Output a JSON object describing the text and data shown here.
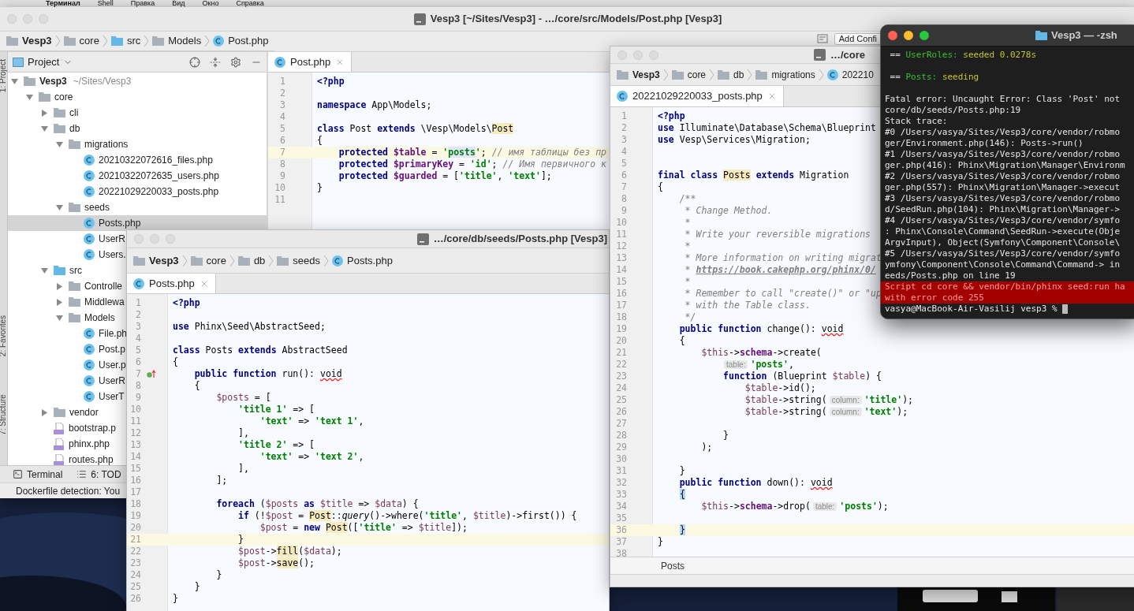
{
  "menu_bar": {
    "items": [
      "Терминал",
      "Shell",
      "Правка",
      "Вид",
      "Окно",
      "Справка"
    ]
  },
  "main_window": {
    "focused": false,
    "title": "Vesp3 [~/Sites/Vesp3] - …/core/src/Models/Post.php [Vesp3]",
    "breadcrumb": [
      {
        "kind": "folder",
        "text": "Vesp3"
      },
      {
        "kind": "folder",
        "text": "core"
      },
      {
        "kind": "source",
        "text": "src"
      },
      {
        "kind": "folder",
        "text": "Models"
      },
      {
        "kind": "class",
        "text": "Post.php"
      }
    ],
    "run_config": "Add Confi",
    "side_tabs": [
      "1: Project",
      "2: Favorites",
      "7: Structure"
    ],
    "project_panel": {
      "header": "Project",
      "tree": [
        {
          "label": "Vesp3",
          "path": "~/Sites/Vesp3",
          "kind": "folder",
          "expanded": true,
          "selected": false,
          "children": [
            {
              "label": "core",
              "kind": "folder",
              "expanded": true,
              "selected": false,
              "children": [
                {
                  "label": "cli",
                  "kind": "folder",
                  "expanded": false,
                  "selected": false
                },
                {
                  "label": "db",
                  "kind": "folder",
                  "expanded": true,
                  "selected": false,
                  "children": [
                    {
                      "label": "migrations",
                      "kind": "folder",
                      "expanded": true,
                      "selected": false,
                      "children": [
                        {
                          "label": "20210322072616_files.php",
                          "kind": "class",
                          "selected": false
                        },
                        {
                          "label": "20210322072635_users.php",
                          "kind": "class",
                          "selected": false
                        },
                        {
                          "label": "20221029220033_posts.php",
                          "kind": "class",
                          "selected": false
                        }
                      ]
                    },
                    {
                      "label": "seeds",
                      "kind": "folder",
                      "expanded": true,
                      "selected": false,
                      "children": [
                        {
                          "label": "Posts.php",
                          "kind": "class",
                          "selected": true
                        },
                        {
                          "label": "UserR",
                          "kind": "class",
                          "selected": false
                        },
                        {
                          "label": "Users.",
                          "kind": "class",
                          "selected": false
                        }
                      ]
                    }
                  ]
                },
                {
                  "label": "src",
                  "kind": "source",
                  "expanded": true,
                  "selected": false,
                  "children": [
                    {
                      "label": "Controlle",
                      "kind": "folder",
                      "expanded": false,
                      "selected": false
                    },
                    {
                      "label": "Middlewa",
                      "kind": "folder",
                      "expanded": false,
                      "selected": false
                    },
                    {
                      "label": "Models",
                      "kind": "folder",
                      "expanded": true,
                      "selected": false,
                      "children": [
                        {
                          "label": "File.ph",
                          "kind": "class",
                          "selected": false
                        },
                        {
                          "label": "Post.p",
                          "kind": "class",
                          "selected": false
                        },
                        {
                          "label": "User.p",
                          "kind": "class",
                          "selected": false
                        },
                        {
                          "label": "UserR",
                          "kind": "class",
                          "selected": false
                        },
                        {
                          "label": "UserT",
                          "kind": "class",
                          "selected": false
                        }
                      ]
                    }
                  ]
                },
                {
                  "label": "vendor",
                  "kind": "folder",
                  "expanded": false,
                  "selected": false
                },
                {
                  "label": "bootstrap.p",
                  "kind": "php",
                  "selected": false
                },
                {
                  "label": "phinx.php",
                  "kind": "php",
                  "selected": false
                },
                {
                  "label": "routes.php",
                  "kind": "php",
                  "selected": false
                }
              ]
            }
          ]
        }
      ]
    },
    "tabs": [
      {
        "label": "Post.php",
        "selected": true
      }
    ],
    "lines": [
      {
        "n": "1",
        "current": false,
        "tokens": [
          {
            "kind": "kw",
            "text": "<?php"
          }
        ]
      },
      {
        "n": "2",
        "current": false
      },
      {
        "n": "3",
        "current": false,
        "tokens": [
          {
            "kind": "kw",
            "text": "namespace"
          },
          {
            "kind": "plain",
            "text": " App\\Models;"
          }
        ]
      },
      {
        "n": "4",
        "current": false
      },
      {
        "n": "5",
        "current": false,
        "tokens": [
          {
            "kind": "kw",
            "text": "class"
          },
          {
            "kind": "plain",
            "text": " Post "
          },
          {
            "kind": "kw",
            "text": "extends"
          },
          {
            "kind": "plain",
            "text": " \\Vesp\\Models\\"
          },
          {
            "kind": "mark",
            "text": "Post"
          }
        ]
      },
      {
        "n": "6",
        "current": false,
        "tokens": [
          {
            "kind": "plain",
            "text": "{"
          }
        ]
      },
      {
        "n": "7",
        "current": true,
        "tokens": [
          {
            "kind": "kw",
            "text": "    protected"
          },
          {
            "kind": "field",
            "text": " $table"
          },
          {
            "kind": "plain",
            "text": " = "
          },
          {
            "kind": "str",
            "text": "'"
          },
          {
            "kind": "strsel",
            "text": "posts"
          },
          {
            "kind": "str",
            "text": "'"
          },
          {
            "kind": "plain",
            "text": "; "
          },
          {
            "kind": "comment",
            "text": "// имя таблицы без пр"
          }
        ]
      },
      {
        "n": "8",
        "current": false,
        "tokens": [
          {
            "kind": "kw",
            "text": "    protected"
          },
          {
            "kind": "field",
            "text": " $primaryKey"
          },
          {
            "kind": "plain",
            "text": " = "
          },
          {
            "kind": "str",
            "text": "'id'"
          },
          {
            "kind": "plain",
            "text": "; "
          },
          {
            "kind": "comment",
            "text": "// Имя первичного к"
          }
        ]
      },
      {
        "n": "9",
        "current": false,
        "tokens": [
          {
            "kind": "kw",
            "text": "    protected"
          },
          {
            "kind": "field",
            "text": " $guarded"
          },
          {
            "kind": "plain",
            "text": " = ["
          },
          {
            "kind": "str",
            "text": "'title'"
          },
          {
            "kind": "plain",
            "text": ", "
          },
          {
            "kind": "str",
            "text": "'text'"
          },
          {
            "kind": "plain",
            "text": "];"
          }
        ]
      },
      {
        "n": "10",
        "current": false,
        "tokens": [
          {
            "kind": "plain",
            "text": "}"
          }
        ]
      },
      {
        "n": "11",
        "current": false
      }
    ],
    "tool_tabs": [
      {
        "kind": "terminal",
        "label": "Terminal"
      },
      {
        "kind": "todo",
        "label": "6: TOD"
      }
    ],
    "status": "Dockerfile detection: You"
  },
  "seeds_window": {
    "focused": false,
    "title": "…/core/db/seeds/Posts.php [Vesp3]",
    "breadcrumb": [
      {
        "kind": "folder",
        "text": "Vesp3"
      },
      {
        "kind": "folder",
        "text": "core"
      },
      {
        "kind": "folder",
        "text": "db"
      },
      {
        "kind": "folder",
        "text": "seeds"
      },
      {
        "kind": "class",
        "text": "Posts.php"
      }
    ],
    "tabs": [
      {
        "label": "Posts.php",
        "selected": true
      }
    ],
    "lines": [
      {
        "n": "1",
        "current": false,
        "tokens": [
          {
            "kind": "kw",
            "text": "<?php"
          }
        ]
      },
      {
        "n": "2",
        "current": false
      },
      {
        "n": "3",
        "current": false,
        "tokens": [
          {
            "kind": "kw",
            "text": "use"
          },
          {
            "kind": "plain",
            "text": " Phinx\\Seed\\AbstractSeed;"
          }
        ]
      },
      {
        "n": "4",
        "current": false
      },
      {
        "n": "5",
        "current": false,
        "tokens": [
          {
            "kind": "kw",
            "text": "class"
          },
          {
            "kind": "plain",
            "text": " Posts "
          },
          {
            "kind": "kw",
            "text": "extends"
          },
          {
            "kind": "plain",
            "text": " AbstractSeed"
          }
        ]
      },
      {
        "n": "6",
        "current": false,
        "tokens": [
          {
            "kind": "plain",
            "text": "{"
          }
        ]
      },
      {
        "n": "7",
        "current": false,
        "gutter_icon": true,
        "tokens": [
          {
            "kind": "kw",
            "text": "    public function"
          },
          {
            "kind": "plain",
            "text": " run(): "
          },
          {
            "kind": "err",
            "text": "void"
          }
        ]
      },
      {
        "n": "8",
        "current": false,
        "tokens": [
          {
            "kind": "plain",
            "text": "    {"
          }
        ]
      },
      {
        "n": "9",
        "current": false,
        "tokens": [
          {
            "kind": "var",
            "text": "        $posts"
          },
          {
            "kind": "plain",
            "text": " = ["
          }
        ]
      },
      {
        "n": "10",
        "current": false,
        "tokens": [
          {
            "kind": "str",
            "text": "            'title 1'"
          },
          {
            "kind": "plain",
            "text": " => ["
          }
        ]
      },
      {
        "n": "11",
        "current": false,
        "tokens": [
          {
            "kind": "str",
            "text": "                'text'"
          },
          {
            "kind": "plain",
            "text": " => "
          },
          {
            "kind": "str",
            "text": "'text 1'"
          },
          {
            "kind": "plain",
            "text": ","
          }
        ]
      },
      {
        "n": "12",
        "current": false,
        "tokens": [
          {
            "kind": "plain",
            "text": "            ],"
          }
        ]
      },
      {
        "n": "13",
        "current": false,
        "tokens": [
          {
            "kind": "str",
            "text": "            'title 2'"
          },
          {
            "kind": "plain",
            "text": " => ["
          }
        ]
      },
      {
        "n": "14",
        "current": false,
        "tokens": [
          {
            "kind": "str",
            "text": "                'text'"
          },
          {
            "kind": "plain",
            "text": " => "
          },
          {
            "kind": "str",
            "text": "'text 2'"
          },
          {
            "kind": "plain",
            "text": ","
          }
        ]
      },
      {
        "n": "15",
        "current": false,
        "tokens": [
          {
            "kind": "plain",
            "text": "            ],"
          }
        ]
      },
      {
        "n": "16",
        "current": false,
        "tokens": [
          {
            "kind": "plain",
            "text": "        ];"
          }
        ]
      },
      {
        "n": "17",
        "current": false
      },
      {
        "n": "18",
        "current": false,
        "tokens": [
          {
            "kind": "kw",
            "text": "        foreach"
          },
          {
            "kind": "plain",
            "text": " ("
          },
          {
            "kind": "var",
            "text": "$posts"
          },
          {
            "kind": "kw",
            "text": " as"
          },
          {
            "kind": "var",
            "text": " $title"
          },
          {
            "kind": "plain",
            "text": " => "
          },
          {
            "kind": "var",
            "text": "$data"
          },
          {
            "kind": "plain",
            "text": ") {"
          }
        ]
      },
      {
        "n": "19",
        "current": false,
        "tokens": [
          {
            "kind": "kw",
            "text": "            if"
          },
          {
            "kind": "plain",
            "text": " (!"
          },
          {
            "kind": "var",
            "text": "$post"
          },
          {
            "kind": "plain",
            "text": " = "
          },
          {
            "kind": "mark",
            "text": "Post"
          },
          {
            "kind": "plain",
            "text": "::"
          },
          {
            "kind": "italic",
            "text": "query"
          },
          {
            "kind": "plain",
            "text": "()->where("
          },
          {
            "kind": "str",
            "text": "'title'"
          },
          {
            "kind": "plain",
            "text": ", "
          },
          {
            "kind": "var",
            "text": "$title"
          },
          {
            "kind": "plain",
            "text": ")->first()) {"
          }
        ]
      },
      {
        "n": "20",
        "current": false,
        "tokens": [
          {
            "kind": "var",
            "text": "                $post"
          },
          {
            "kind": "plain",
            "text": " = "
          },
          {
            "kind": "kw",
            "text": "new "
          },
          {
            "kind": "mark",
            "text": "Post"
          },
          {
            "kind": "plain",
            "text": "(["
          },
          {
            "kind": "str",
            "text": "'title'"
          },
          {
            "kind": "plain",
            "text": " => "
          },
          {
            "kind": "var",
            "text": "$title"
          },
          {
            "kind": "plain",
            "text": "]);"
          }
        ]
      },
      {
        "n": "21",
        "current": true,
        "tokens": [
          {
            "kind": "plain",
            "text": "            }"
          }
        ]
      },
      {
        "n": "22",
        "current": false,
        "tokens": [
          {
            "kind": "var",
            "text": "            $post"
          },
          {
            "kind": "plain",
            "text": "->"
          },
          {
            "kind": "mark",
            "text": "fill"
          },
          {
            "kind": "plain",
            "text": "("
          },
          {
            "kind": "var",
            "text": "$data"
          },
          {
            "kind": "plain",
            "text": ");"
          }
        ]
      },
      {
        "n": "23",
        "current": false,
        "tokens": [
          {
            "kind": "var",
            "text": "            $post"
          },
          {
            "kind": "plain",
            "text": "->"
          },
          {
            "kind": "mark",
            "text": "save"
          },
          {
            "kind": "plain",
            "text": "();"
          }
        ]
      },
      {
        "n": "24",
        "current": false,
        "tokens": [
          {
            "kind": "plain",
            "text": "        }"
          }
        ]
      },
      {
        "n": "25",
        "current": false,
        "tokens": [
          {
            "kind": "plain",
            "text": "    }"
          }
        ]
      },
      {
        "n": "26",
        "current": false,
        "tokens": [
          {
            "kind": "plain",
            "text": "}"
          }
        ]
      }
    ]
  },
  "migration_window": {
    "focused": false,
    "title": "…/core",
    "breadcrumb": [
      {
        "kind": "folder",
        "text": "Vesp3"
      },
      {
        "kind": "folder",
        "text": "core"
      },
      {
        "kind": "folder",
        "text": "db"
      },
      {
        "kind": "folder",
        "text": "migrations"
      },
      {
        "kind": "class",
        "text": "202210"
      }
    ],
    "tabs": [
      {
        "label": "20221029220033_posts.php",
        "selected": true
      }
    ],
    "lines": [
      {
        "n": "1",
        "current": false,
        "tokens": [
          {
            "kind": "kw",
            "text": "<?php"
          }
        ]
      },
      {
        "n": "2",
        "current": false,
        "tokens": [
          {
            "kind": "kw",
            "text": "use"
          },
          {
            "kind": "plain",
            "text": " Illuminate\\Database\\Schema\\Blueprint"
          }
        ]
      },
      {
        "n": "3",
        "current": false,
        "tokens": [
          {
            "kind": "kw",
            "text": "use"
          },
          {
            "kind": "plain",
            "text": " Vesp\\Services\\Migration;"
          }
        ]
      },
      {
        "n": "4",
        "current": false
      },
      {
        "n": "5",
        "current": false
      },
      {
        "n": "6",
        "current": false,
        "tokens": [
          {
            "kind": "kw",
            "text": "final class "
          },
          {
            "kind": "mark",
            "text": "Posts"
          },
          {
            "kind": "kw",
            "text": " extends"
          },
          {
            "kind": "plain",
            "text": " Migration"
          }
        ]
      },
      {
        "n": "7",
        "current": false,
        "tokens": [
          {
            "kind": "plain",
            "text": "{"
          }
        ]
      },
      {
        "n": "8",
        "current": false,
        "tokens": [
          {
            "kind": "comment",
            "text": "    /**"
          }
        ]
      },
      {
        "n": "9",
        "current": false,
        "tokens": [
          {
            "kind": "comment",
            "text": "     * Change Method."
          }
        ]
      },
      {
        "n": "10",
        "current": false,
        "tokens": [
          {
            "kind": "comment",
            "text": "     *"
          }
        ]
      },
      {
        "n": "11",
        "current": false,
        "tokens": [
          {
            "kind": "comment",
            "text": "     * Write your reversible migrations"
          }
        ]
      },
      {
        "n": "12",
        "current": false,
        "tokens": [
          {
            "kind": "comment",
            "text": "     *"
          }
        ]
      },
      {
        "n": "13",
        "current": false,
        "tokens": [
          {
            "kind": "comment",
            "text": "     * More information on writing migrat"
          }
        ]
      },
      {
        "n": "14",
        "current": false,
        "tokens": [
          {
            "kind": "comment",
            "text": "     * "
          },
          {
            "kind": "link",
            "text": "https://book.cakephp.org/phinx/0/"
          }
        ]
      },
      {
        "n": "15",
        "current": false,
        "tokens": [
          {
            "kind": "comment",
            "text": "     *"
          }
        ]
      },
      {
        "n": "16",
        "current": false,
        "tokens": [
          {
            "kind": "comment",
            "text": "     * Remember to call \"create()\" or \"up"
          }
        ]
      },
      {
        "n": "17",
        "current": false,
        "tokens": [
          {
            "kind": "comment",
            "text": "     * with the Table class."
          }
        ]
      },
      {
        "n": "18",
        "current": false,
        "tokens": [
          {
            "kind": "comment",
            "text": "     */"
          }
        ]
      },
      {
        "n": "19",
        "current": false,
        "tokens": [
          {
            "kind": "kw",
            "text": "    public function"
          },
          {
            "kind": "plain",
            "text": " change(): "
          },
          {
            "kind": "err",
            "text": "void"
          }
        ]
      },
      {
        "n": "20",
        "current": false,
        "tokens": [
          {
            "kind": "plain",
            "text": "    {"
          }
        ]
      },
      {
        "n": "21",
        "current": false,
        "tokens": [
          {
            "kind": "var",
            "text": "        $this"
          },
          {
            "kind": "plain",
            "text": "->"
          },
          {
            "kind": "member",
            "text": "schema"
          },
          {
            "kind": "plain",
            "text": "->create("
          }
        ]
      },
      {
        "n": "22",
        "current": false,
        "tokens": [
          {
            "kind": "hint_lead",
            "text": "table:"
          },
          {
            "kind": "str",
            "text": "'posts'"
          },
          {
            "kind": "plain",
            "text": ","
          }
        ]
      },
      {
        "n": "23",
        "current": false,
        "tokens": [
          {
            "kind": "kw",
            "text": "            function"
          },
          {
            "kind": "plain",
            "text": " (Blueprint "
          },
          {
            "kind": "var",
            "text": "$table"
          },
          {
            "kind": "plain",
            "text": ") {"
          }
        ]
      },
      {
        "n": "24",
        "current": false,
        "tokens": [
          {
            "kind": "var",
            "text": "                $table"
          },
          {
            "kind": "plain",
            "text": "->id();"
          }
        ]
      },
      {
        "n": "25",
        "current": false,
        "tokens": [
          {
            "kind": "var",
            "text": "                $table"
          },
          {
            "kind": "plain",
            "text": "->string("
          },
          {
            "kind": "hint",
            "text": "column:"
          },
          {
            "kind": "str",
            "text": "'title'"
          },
          {
            "kind": "plain",
            "text": ");"
          }
        ]
      },
      {
        "n": "26",
        "current": false,
        "tokens": [
          {
            "kind": "var",
            "text": "                $table"
          },
          {
            "kind": "plain",
            "text": "->string("
          },
          {
            "kind": "hint",
            "text": "column:"
          },
          {
            "kind": "str",
            "text": "'text'"
          },
          {
            "kind": "plain",
            "text": ");"
          }
        ]
      },
      {
        "n": "27",
        "current": false
      },
      {
        "n": "28",
        "current": false,
        "tokens": [
          {
            "kind": "plain",
            "text": "            }"
          }
        ]
      },
      {
        "n": "29",
        "current": false,
        "tokens": [
          {
            "kind": "plain",
            "text": "        );"
          }
        ]
      },
      {
        "n": "30",
        "current": false
      },
      {
        "n": "31",
        "current": false,
        "tokens": [
          {
            "kind": "plain",
            "text": "    }"
          }
        ]
      },
      {
        "n": "32",
        "current": false,
        "tokens": [
          {
            "kind": "kw",
            "text": "    public function"
          },
          {
            "kind": "plain",
            "text": " down(): "
          },
          {
            "kind": "err",
            "text": "void"
          }
        ]
      },
      {
        "n": "33",
        "current": false,
        "tokens": [
          {
            "kind": "sel_lead",
            "text": "{"
          }
        ]
      },
      {
        "n": "34",
        "current": false,
        "tokens": [
          {
            "kind": "var",
            "text": "        $this"
          },
          {
            "kind": "plain",
            "text": "->"
          },
          {
            "kind": "member",
            "text": "schema"
          },
          {
            "kind": "plain",
            "text": "->drop("
          },
          {
            "kind": "hint",
            "text": "table:"
          },
          {
            "kind": "str",
            "text": "'posts'"
          },
          {
            "kind": "plain",
            "text": ");"
          }
        ]
      },
      {
        "n": "35",
        "current": false
      },
      {
        "n": "36",
        "current": true,
        "tokens": [
          {
            "kind": "sel_lead",
            "text": "}"
          }
        ]
      },
      {
        "n": "37",
        "current": false,
        "tokens": [
          {
            "kind": "plain",
            "text": "}"
          }
        ]
      },
      {
        "n": "38",
        "current": false
      }
    ],
    "structure_bar": "Posts"
  },
  "terminal_window": {
    "focused": true,
    "title": "Vesp3 — -zsh",
    "lines": [
      {
        "kind": "status",
        "prefix": " == ",
        "name": "UserRoles:",
        "message": "seeded 0.0278s"
      },
      {
        "kind": "blank"
      },
      {
        "kind": "status",
        "prefix": " == ",
        "name": "Posts:",
        "message": "seeding"
      },
      {
        "kind": "blank"
      },
      {
        "kind": "output",
        "text": "Fatal error: Uncaught Error: Class 'Post' not"
      },
      {
        "kind": "output",
        "text": "core/db/seeds/Posts.php:19"
      },
      {
        "kind": "output",
        "text": "Stack trace:"
      },
      {
        "kind": "output",
        "text": "#0 /Users/vasya/Sites/Vesp3/core/vendor/robmo"
      },
      {
        "kind": "output",
        "text": "ger/Environment.php(146): Posts->run()"
      },
      {
        "kind": "output",
        "text": "#1 /Users/vasya/Sites/Vesp3/core/vendor/robmo"
      },
      {
        "kind": "output",
        "text": "ger.php(416): Phinx\\Migration\\Manager\\Environm"
      },
      {
        "kind": "output",
        "text": "#2 /Users/vasya/Sites/Vesp3/core/vendor/robmo"
      },
      {
        "kind": "output",
        "text": "ger.php(557): Phinx\\Migration\\Manager->execut"
      },
      {
        "kind": "output",
        "text": "#3 /Users/vasya/Sites/Vesp3/core/vendor/robmo"
      },
      {
        "kind": "output",
        "text": "d/SeedRun.php(104): Phinx\\Migration\\Manager->"
      },
      {
        "kind": "output",
        "text": "#4 /Users/vasya/Sites/Vesp3/core/vendor/symfo"
      },
      {
        "kind": "output",
        "text": ": Phinx\\Console\\Command\\SeedRun->execute(Obje"
      },
      {
        "kind": "output",
        "text": "ArgvInput), Object(Symfony\\Component\\Console\\"
      },
      {
        "kind": "output",
        "text": "#5 /Users/vasya/Sites/Vesp3/core/vendor/symfo"
      },
      {
        "kind": "output",
        "text": "ymfony\\Component\\Console\\Command\\Command-> in"
      },
      {
        "kind": "output",
        "text": "eeds/Posts.php on line 19"
      },
      {
        "kind": "error",
        "text": "Script cd core && vendor/bin/phinx seed:run ha"
      },
      {
        "kind": "error",
        "text": "with error code 255"
      },
      {
        "kind": "prompt",
        "text": "vasya@MacBook-Air-Vasilij vesp3 % "
      }
    ]
  }
}
